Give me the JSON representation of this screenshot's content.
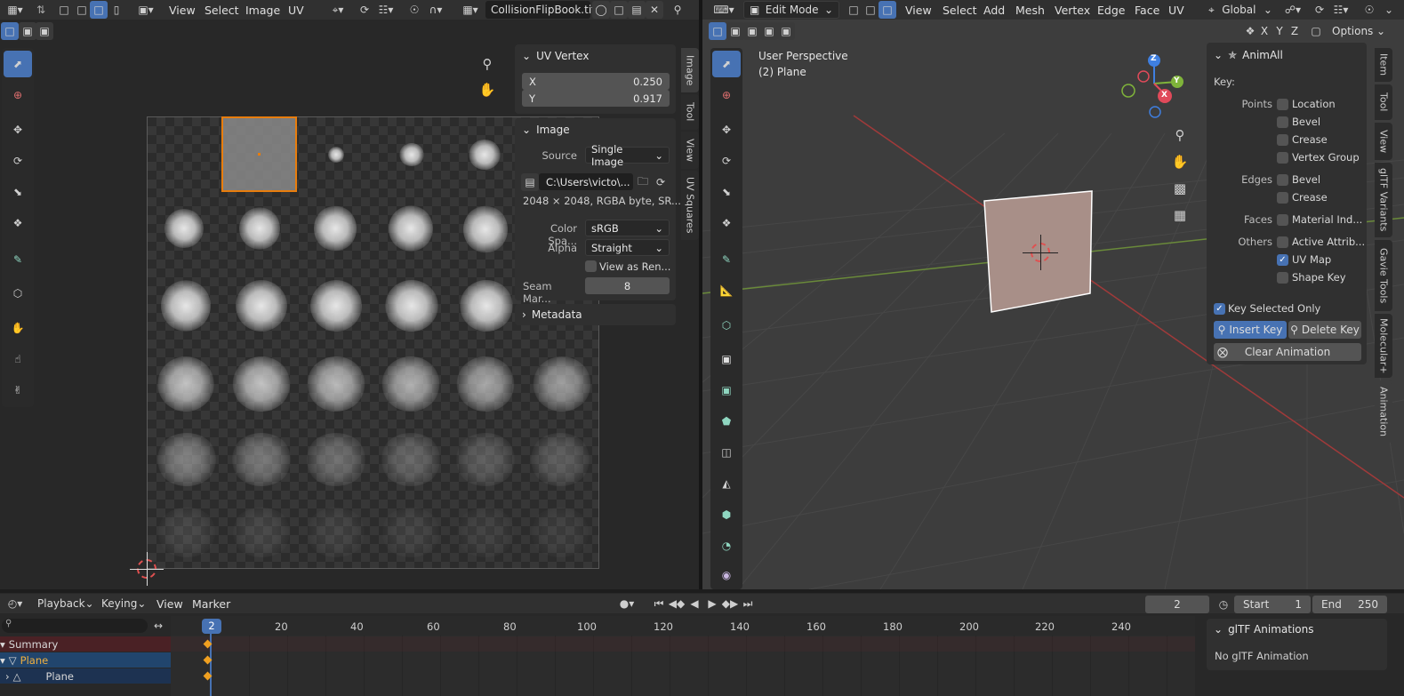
{
  "uv_editor": {
    "header": {
      "menus": [
        "View",
        "Select",
        "Image",
        "UV"
      ],
      "image_name": "CollisionFlipBook.tif"
    },
    "side_tabs": [
      "Image",
      "Tool",
      "View",
      "UV Squares"
    ],
    "uv_vertex_panel": {
      "title": "UV Vertex",
      "x_label": "X",
      "x_value": "0.250",
      "y_label": "Y",
      "y_value": "0.917"
    },
    "image_panel": {
      "title": "Image",
      "source_label": "Source",
      "source_value": "Single Image",
      "filepath": "C:\\Users\\victo\\...",
      "info": "2048 × 2048,  RGBA byte,  SR...",
      "colorspace_label": "Color Spa...",
      "colorspace_value": "sRGB",
      "alpha_label": "Alpha",
      "alpha_value": "Straight",
      "view_as_render": "View as Ren...",
      "seam_label": "Seam Mar...",
      "seam_value": "8"
    },
    "metadata_panel": {
      "title": "Metadata"
    }
  },
  "viewport": {
    "header": {
      "mode": "Edit Mode",
      "menus": [
        "View",
        "Select",
        "Add",
        "Mesh",
        "Vertex",
        "Edge",
        "Face",
        "UV"
      ],
      "orientation": "Global",
      "axes": [
        "X",
        "Y",
        "Z"
      ],
      "options": "Options"
    },
    "overlay_title": "User Perspective",
    "overlay_object": "(2) Plane",
    "gizmo": {
      "x": "X",
      "y": "Y",
      "z": "Z"
    },
    "side_tabs": [
      "Item",
      "Tool",
      "View",
      "glTF Variants",
      "Gavie Tools",
      "Molecular+",
      "Animation"
    ],
    "animall": {
      "title": "AnimAll",
      "key_label": "Key:",
      "groups": [
        {
          "label": "Points",
          "items": [
            {
              "text": "Location",
              "checked": false
            },
            {
              "text": "Bevel",
              "checked": false
            },
            {
              "text": "Crease",
              "checked": false
            },
            {
              "text": "Vertex Group",
              "checked": false
            }
          ]
        },
        {
          "label": "Edges",
          "items": [
            {
              "text": "Bevel",
              "checked": false
            },
            {
              "text": "Crease",
              "checked": false
            }
          ]
        },
        {
          "label": "Faces",
          "items": [
            {
              "text": "Material Ind...",
              "checked": false
            }
          ]
        },
        {
          "label": "Others",
          "items": [
            {
              "text": "Active Attrib...",
              "checked": false
            },
            {
              "text": "UV Map",
              "checked": true
            },
            {
              "text": "Shape Key",
              "checked": false
            }
          ]
        }
      ],
      "key_selected_only": "Key Selected Only",
      "insert_key": "Insert Key",
      "delete_key": "Delete Key",
      "clear_animation": "Clear Animation"
    }
  },
  "timeline": {
    "menus": [
      "Playback",
      "Keying",
      "View",
      "Marker"
    ],
    "current_frame": "2",
    "start_label": "Start",
    "start_value": "1",
    "end_label": "End",
    "end_value": "250",
    "ticks": [
      "20",
      "40",
      "60",
      "80",
      "100",
      "120",
      "140",
      "160",
      "180",
      "200",
      "220",
      "240"
    ],
    "playhead": "2",
    "channels": [
      "Summary",
      "Plane",
      "Plane"
    ],
    "gltf_panel": {
      "title": "glTF Animations",
      "empty": "No glTF Animation"
    }
  },
  "colors": {
    "accent": "#4772b3",
    "selection": "#e87d0d",
    "summary_row": "#4a2125",
    "object_row": "#21456d"
  }
}
